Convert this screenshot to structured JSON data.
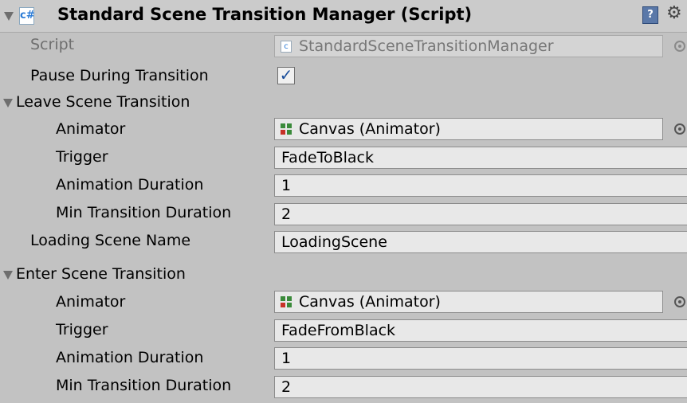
{
  "header": {
    "title": "Standard Scene Transition Manager (Script)",
    "script_icon": "script-icon",
    "script_icon_glyph": "c#",
    "help_glyph": "?",
    "gear_glyph": "⚙"
  },
  "script_row": {
    "label": "Script",
    "value": "StandardSceneTransitionManager"
  },
  "pause_row": {
    "label": "Pause During Transition",
    "checked": true,
    "check_glyph": "✓"
  },
  "leave": {
    "section_label": "Leave Scene Transition",
    "animator_label": "Animator",
    "animator_value": "Canvas (Animator)",
    "trigger_label": "Trigger",
    "trigger_value": "FadeToBlack",
    "anim_duration_label": "Animation Duration",
    "anim_duration_value": "1",
    "min_duration_label": "Min Transition Duration",
    "min_duration_value": "2"
  },
  "loading_row": {
    "label": "Loading Scene Name",
    "value": "LoadingScene"
  },
  "enter": {
    "section_label": "Enter Scene Transition",
    "animator_label": "Animator",
    "animator_value": "Canvas (Animator)",
    "trigger_label": "Trigger",
    "trigger_value": "FadeFromBlack",
    "anim_duration_label": "Animation Duration",
    "anim_duration_value": "1",
    "min_duration_label": "Min Transition Duration",
    "min_duration_value": "2"
  },
  "colors": {
    "background": "#c2c2c2",
    "field": "#e8e8e8",
    "disabled_text": "#6f6f6f",
    "check": "#1b4f9b"
  }
}
